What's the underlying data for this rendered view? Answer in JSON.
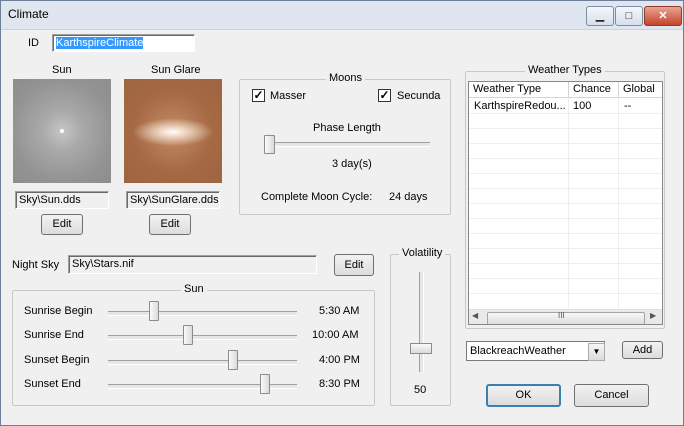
{
  "window": {
    "title": "Climate",
    "minimize_glyph": "▁",
    "maximize_glyph": "□",
    "close_glyph": "✕"
  },
  "id": {
    "label": "ID",
    "value": "KarthspireClimate"
  },
  "sun_image": {
    "label": "Sun",
    "path": "Sky\\Sun.dds",
    "edit_label": "Edit"
  },
  "sun_glare": {
    "label": "Sun Glare",
    "path": "Sky\\SunGlare.dds",
    "edit_label": "Edit"
  },
  "night_sky": {
    "label": "Night Sky",
    "path": "Sky\\Stars.nif",
    "edit_label": "Edit"
  },
  "moons": {
    "title": "Moons",
    "masser": {
      "label": "Masser",
      "checked": true
    },
    "secunda": {
      "label": "Secunda",
      "checked": true
    },
    "phase_length_label": "Phase Length",
    "phase_value": "3 day(s)",
    "cycle_label": "Complete Moon Cycle:",
    "cycle_value": "24 days",
    "check_glyph": "✓"
  },
  "sun_times": {
    "title": "Sun",
    "rows": [
      {
        "label": "Sunrise Begin",
        "value": "5:30 AM",
        "fraction": 0.23
      },
      {
        "label": "Sunrise End",
        "value": "10:00 AM",
        "fraction": 0.42
      },
      {
        "label": "Sunset Begin",
        "value": "4:00 PM",
        "fraction": 0.67
      },
      {
        "label": "Sunset End",
        "value": "8:30 PM",
        "fraction": 0.85
      }
    ]
  },
  "volatility": {
    "label": "Volatility",
    "value": "50"
  },
  "weather_types": {
    "title": "Weather Types",
    "columns": [
      "Weather Type",
      "Chance",
      "Global"
    ],
    "rows": [
      {
        "weather": "KarthspireRedou...",
        "chance": "100",
        "global": "--"
      }
    ],
    "scroll_grip": "III",
    "scroll_left": "◀",
    "scroll_right": "▶"
  },
  "add_weather": {
    "selected": "BlackreachWeather",
    "arrow": "▼",
    "add_label": "Add"
  },
  "footer": {
    "ok_label": "OK",
    "cancel_label": "Cancel"
  },
  "colors": {
    "accent": "#3399ff",
    "titlebar": "#dfe6ef",
    "dialog_bg": "#f0f0f0"
  }
}
